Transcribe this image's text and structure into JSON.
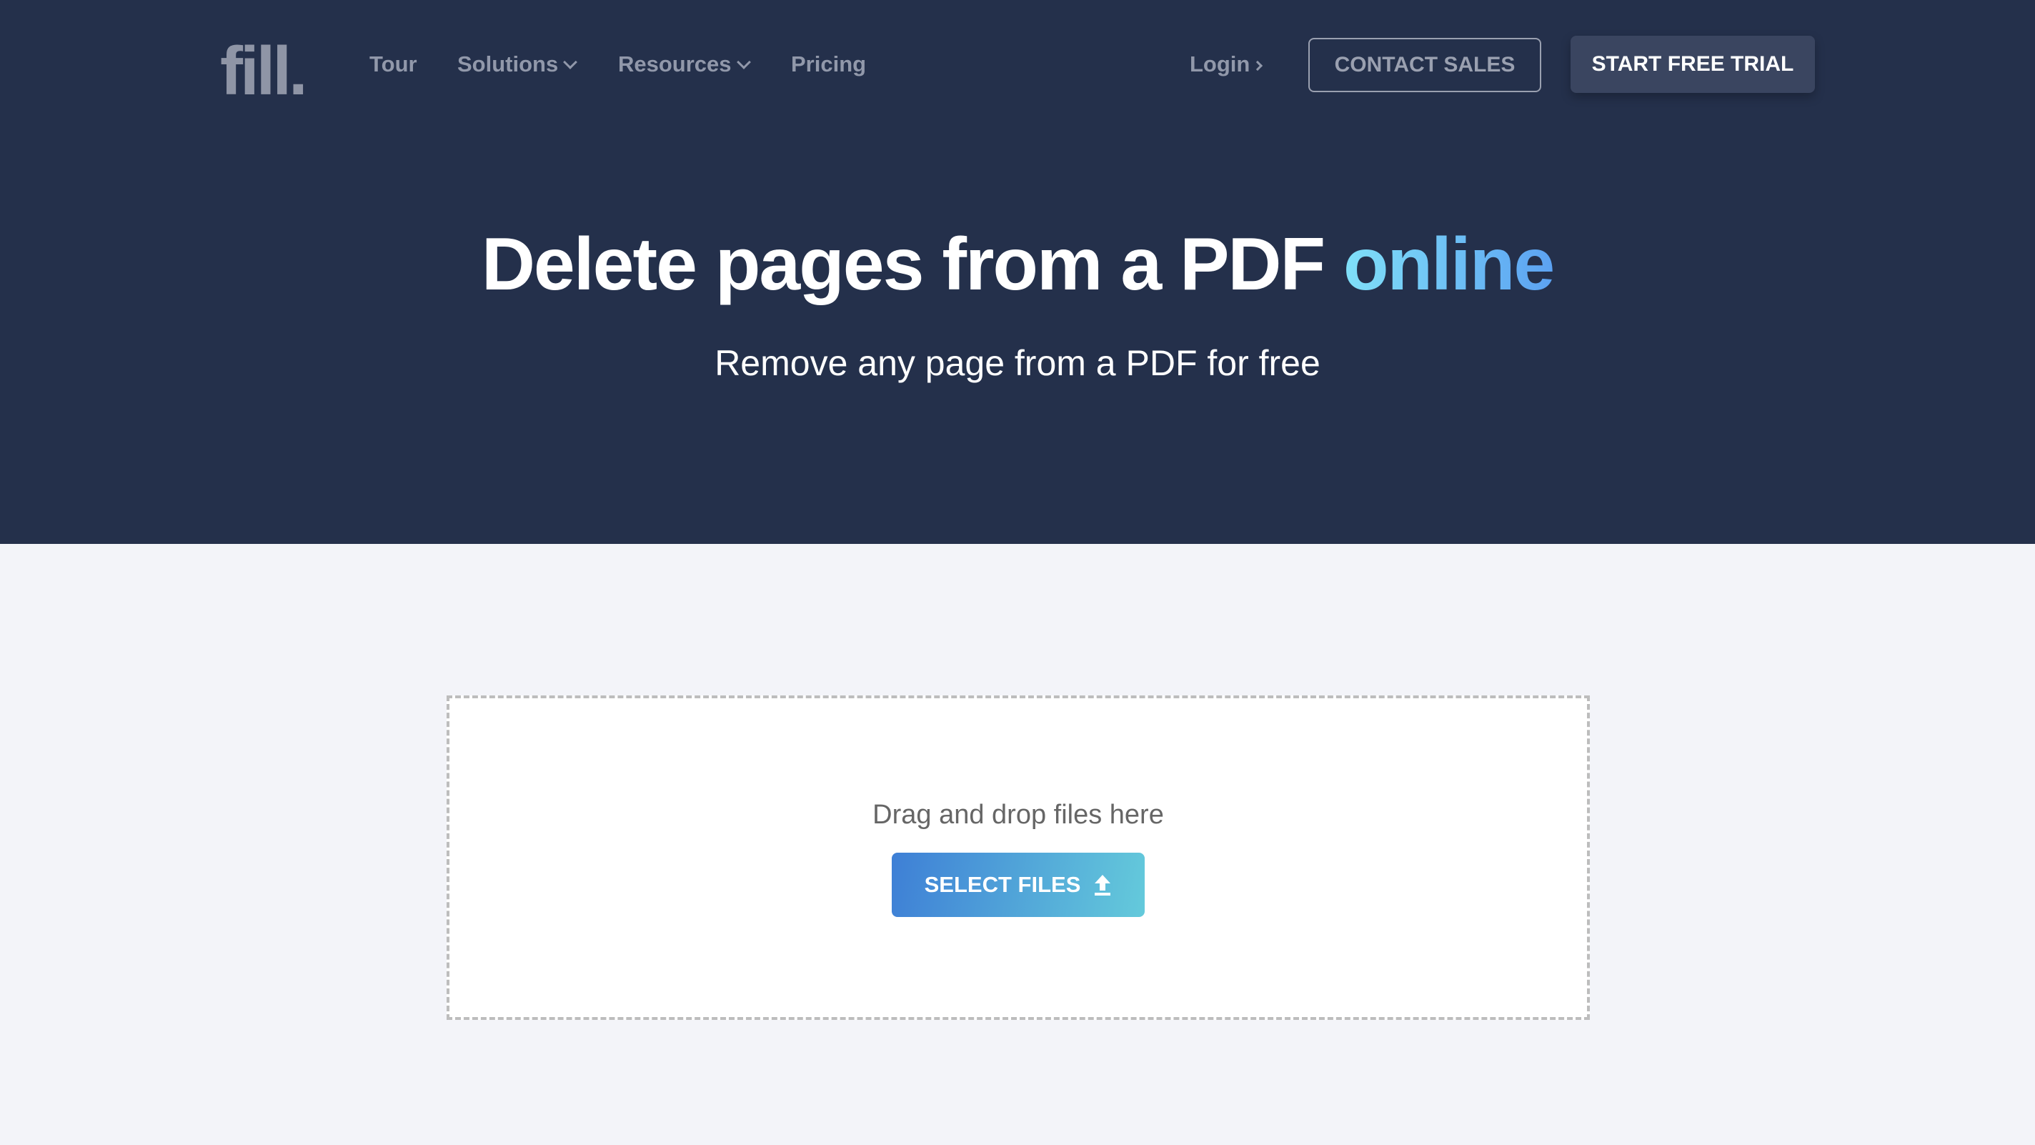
{
  "header": {
    "logo": "fill.",
    "nav": [
      {
        "label": "Tour",
        "has_dropdown": false
      },
      {
        "label": "Solutions",
        "has_dropdown": true,
        "icon": "chevron-down-icon"
      },
      {
        "label": "Resources",
        "has_dropdown": true,
        "icon": "chevron-down-icon"
      },
      {
        "label": "Pricing",
        "has_dropdown": false
      }
    ],
    "login_label": "Login",
    "login_icon": "chevron-right-icon",
    "contact_sales_label": "CONTACT SALES",
    "start_trial_label": "START FREE TRIAL"
  },
  "hero": {
    "title_main": "Delete pages from a PDF ",
    "title_accent": "online",
    "subtitle": "Remove any page from a PDF for free"
  },
  "upload": {
    "drop_text": "Drag and drop files here",
    "select_label": "SELECT FILES",
    "select_icon": "upload-icon"
  },
  "colors": {
    "hero_bg": "#24304b",
    "page_bg": "#f3f4f9",
    "accent_gradient_start": "#80e0f8",
    "accent_gradient_end": "#5ca2f2",
    "select_gradient_start": "#3e7fd6",
    "select_gradient_end": "#64cadb",
    "trial_button_bg": "#3a4560"
  }
}
